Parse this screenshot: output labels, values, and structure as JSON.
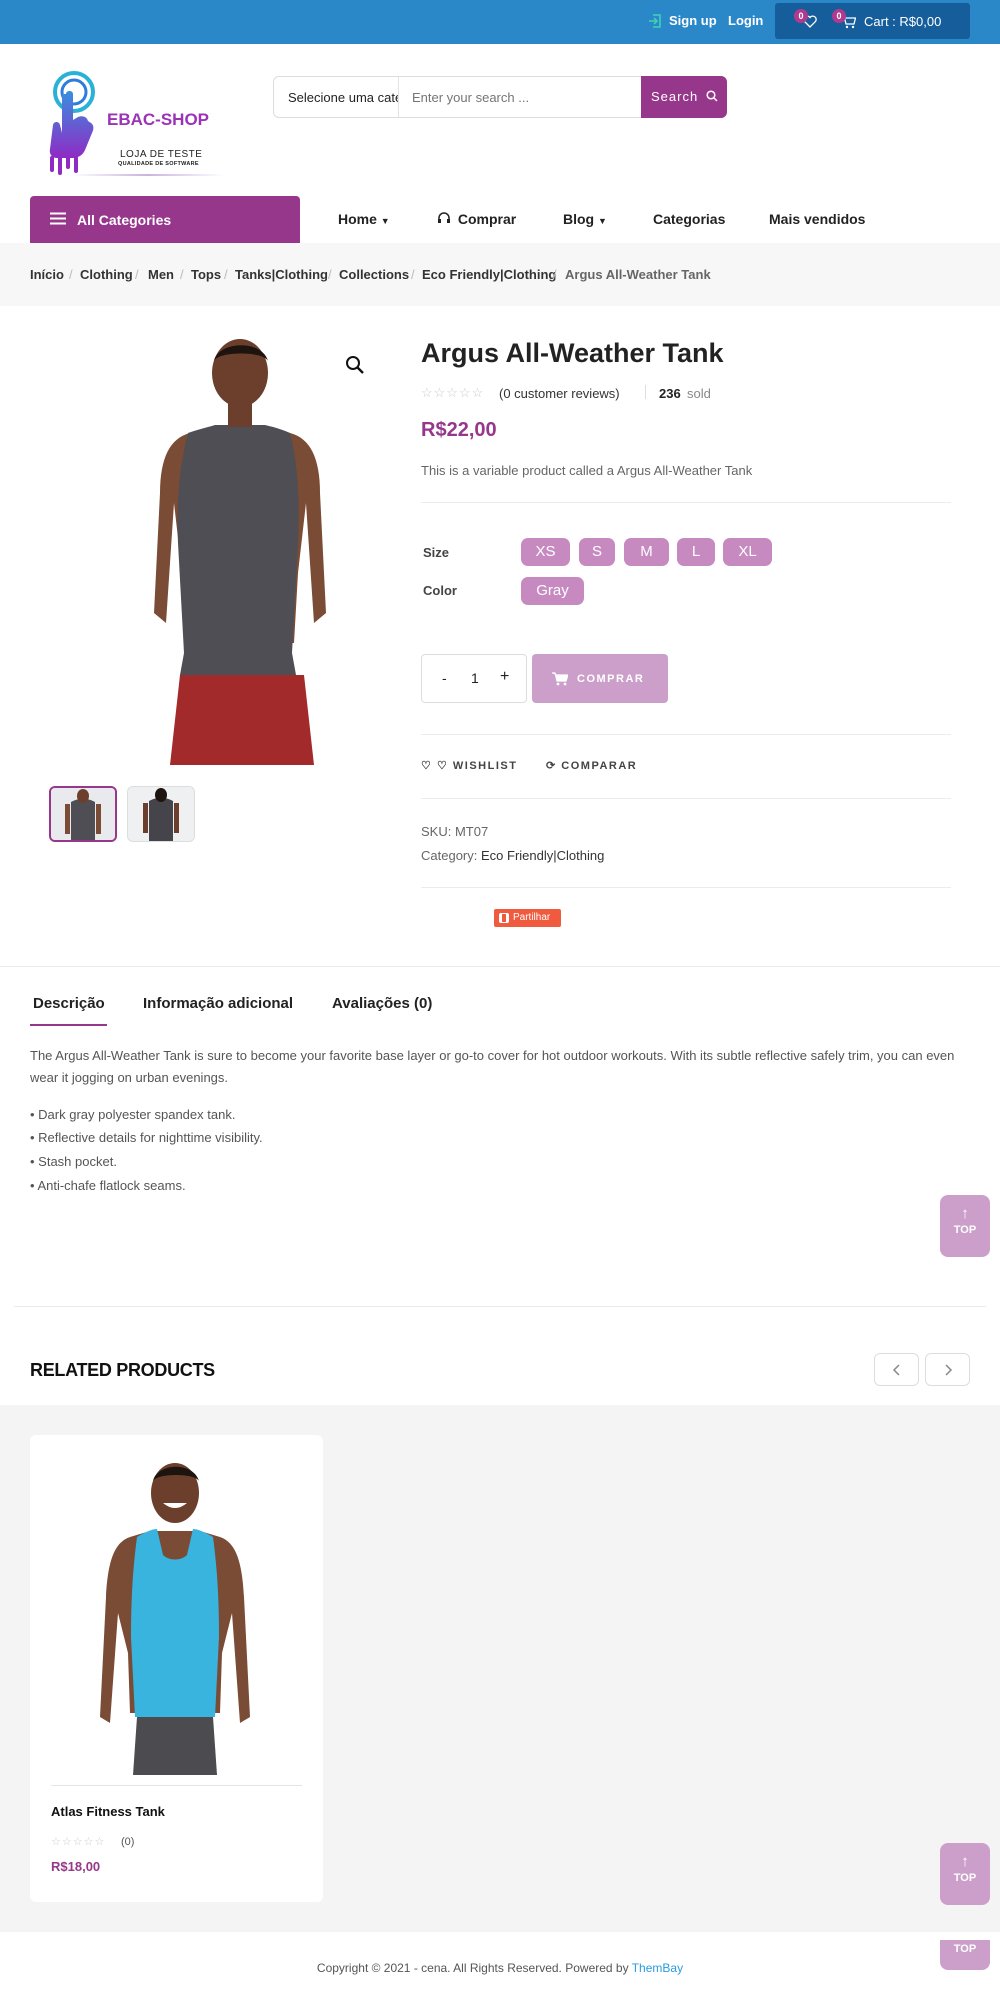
{
  "topbar": {
    "signup_label": "Sign up",
    "login_label": "Login",
    "wishlist_count": "0",
    "cart_count": "0",
    "cart_label": "Cart : R$0,00"
  },
  "header": {
    "logo_title": "EBAC-SHOP",
    "logo_subtitle": "LOJA DE TESTE",
    "logo_tagline": "QUALIDADE DE SOFTWARE",
    "search_category": "Selecione uma categoria",
    "search_placeholder": "Enter your search ...",
    "search_button": "Search"
  },
  "nav": {
    "all_categories": "All Categories",
    "items": [
      {
        "label": "Home"
      },
      {
        "label": "Comprar"
      },
      {
        "label": "Blog"
      },
      {
        "label": "Categorias"
      },
      {
        "label": "Mais vendidos"
      }
    ]
  },
  "breadcrumb": [
    "Início",
    "Clothing",
    "Men",
    "Tops",
    "Tanks|Clothing",
    "Collections",
    "Eco Friendly|Clothing",
    "Argus All-Weather Tank"
  ],
  "product": {
    "title": "Argus All-Weather Tank",
    "reviews_label": "(0 customer reviews)",
    "sold_count": "236",
    "sold_label": "sold",
    "price": "R$22,00",
    "short_description": "This is a variable product called a Argus All-Weather Tank",
    "size_label": "Size",
    "sizes": [
      "XS",
      "S",
      "M",
      "L",
      "XL"
    ],
    "color_label": "Color",
    "colors": [
      "Gray"
    ],
    "qty_minus": "-",
    "quantity": "1",
    "qty_plus": "+",
    "buy_label": "COMPRAR",
    "wishlist_label": "WISHLIST",
    "compare_label": "COMPARAR",
    "sku_label": "SKU:",
    "sku": "MT07",
    "category_label": "Category:",
    "category": "Eco Friendly|Clothing",
    "share_label": "Partilhar",
    "accent_color": "#96378b"
  },
  "tabs": {
    "items": [
      "Descrição",
      "Informação adicional",
      "Avaliações (0)"
    ],
    "active": "Descrição"
  },
  "description": {
    "paragraph": "The Argus All-Weather Tank is sure to become your favorite base layer or go-to cover for hot outdoor workouts. With its subtle reflective safely trim, you can even wear it jogging on urban evenings.",
    "bullets": [
      "• Dark gray polyester spandex tank.",
      "• Reflective details for nighttime visibility.",
      "• Stash pocket.",
      "• Anti-chafe flatlock seams."
    ]
  },
  "back_to_top": {
    "label": "TOP"
  },
  "related": {
    "title": "RELATED PRODUCTS",
    "products": [
      {
        "name": "Atlas Fitness Tank",
        "reviews": "(0)",
        "price": "R$18,00"
      }
    ]
  },
  "footer": {
    "copyright": "Copyright © 2021 - cena. All Rights Reserved. Powered by",
    "powered_by": "ThemBay"
  }
}
